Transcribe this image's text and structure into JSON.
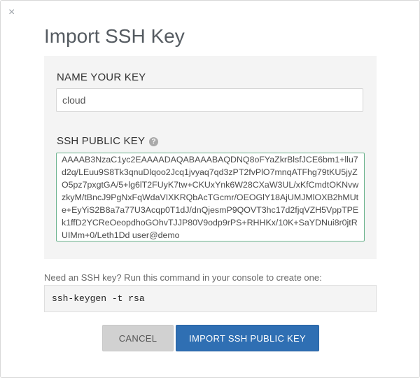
{
  "modal": {
    "close_glyph": "×",
    "title": "Import SSH Key"
  },
  "form": {
    "name_label": "NAME YOUR KEY",
    "name_value": "cloud",
    "key_label": "SSH PUBLIC KEY",
    "help_glyph": "?",
    "key_value": "AAAAB3NzaC1yc2EAAAADAQABAAABAQDNQ8oFYaZkrBlsfJCE6bm1+llu7d2q/LEuu9S8Tk3qnuDlqoo2Jcq1jvyaq7qd3zPT2fvPlO7mnqATFhg79tKU5jyZO5pz7pxgtGA/5+lg6lT2FUyK7tw+CKUxYnk6W28CXaW3UL/xKfCmdtOKNvwzkyM/tBncJ9PgNxFqWdaVIXKRQbAcTGcmr/OEOGlY18AjUMJMlOXB2hMUte+EyYiS2B8a7a77U3Acqp0T1dJ/dnQjesmP9QOVT3hc17d2fjqVZH5VppTPEk1ffD2YCReOeopdhoGOhvTJJP80V9odp9rPS+RHHKx/10K+SaYDNui8r0jtRUIMm+0/Leth1Dd user@demo"
  },
  "hint": {
    "text": "Need an SSH key? Run this command in your console to create one:",
    "command": "ssh-keygen -t rsa"
  },
  "actions": {
    "cancel_label": "CANCEL",
    "import_label": "IMPORT SSH PUBLIC KEY"
  },
  "colors": {
    "primary": "#2f6fb3",
    "panel_bg": "#f4f4f4",
    "focus_border": "#6cb38e"
  }
}
